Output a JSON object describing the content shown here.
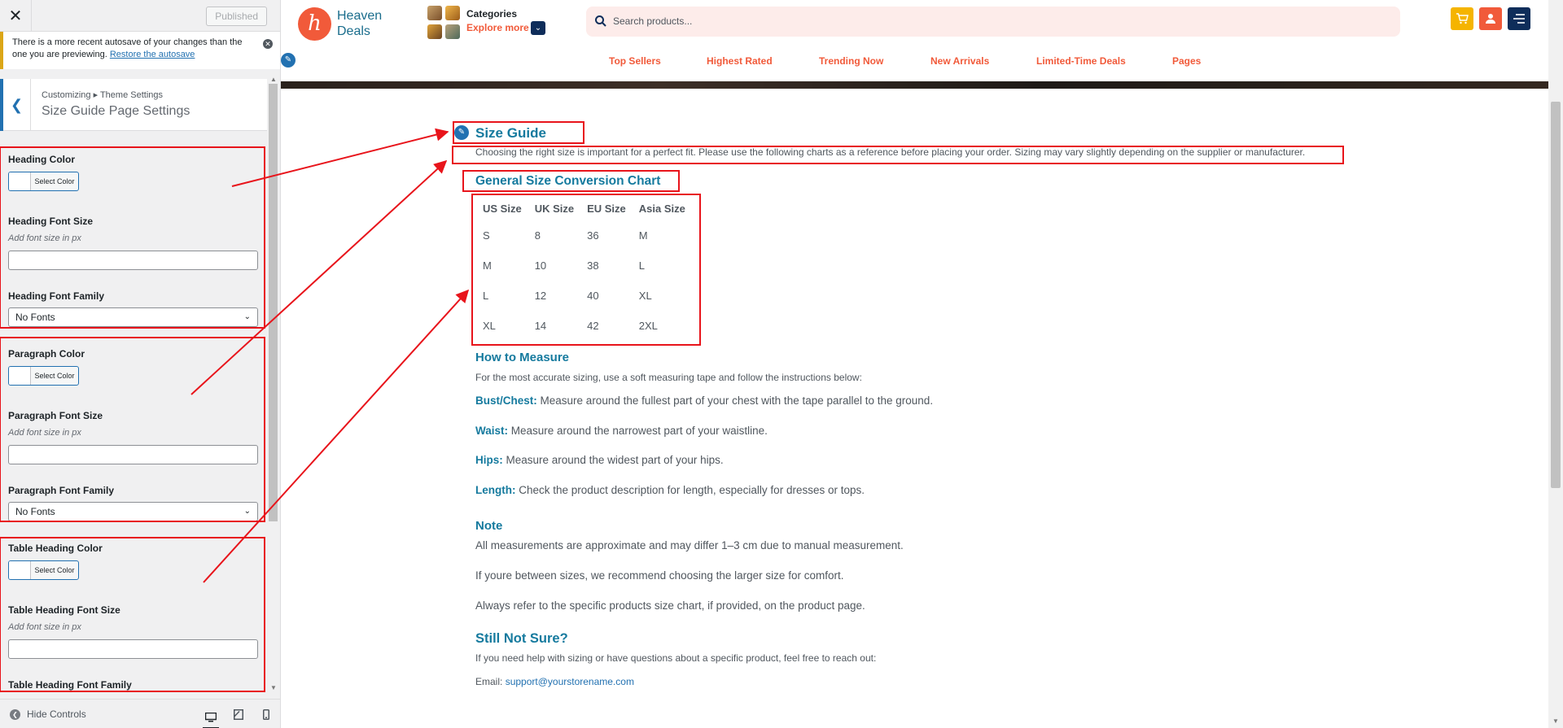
{
  "customizer": {
    "close_icon": "close-icon",
    "publish_label": "Published",
    "notice": {
      "text": "There is a more recent autosave of your changes than the one you are previewing.",
      "link": "Restore the autosave"
    },
    "breadcrumb": "Customizing ▸ Theme Settings",
    "section_title": "Size Guide Page Settings",
    "controls": {
      "heading_color_label": "Heading Color",
      "heading_font_size_label": "Heading Font Size",
      "heading_font_family_label": "Heading Font Family",
      "paragraph_color_label": "Paragraph Color",
      "paragraph_font_size_label": "Paragraph Font Size",
      "paragraph_font_family_label": "Paragraph Font Family",
      "table_heading_color_label": "Table Heading Color",
      "table_heading_font_size_label": "Table Heading Font Size",
      "table_heading_font_family_label": "Table Heading Font Family",
      "select_color_label": "Select Color",
      "font_size_desc": "Add font size in px",
      "font_family_value": "No Fonts"
    },
    "footer": {
      "hide_controls": "Hide Controls"
    }
  },
  "site": {
    "logo_letter": "h",
    "logo_line1": "Heaven",
    "logo_line2": "Deals",
    "categories_title": "Categories",
    "categories_explore": "Explore more",
    "search_placeholder": "Search products...",
    "nav": [
      "Top Sellers",
      "Highest Rated",
      "Trending Now",
      "New Arrivals",
      "Limited-Time Deals",
      "Pages"
    ],
    "accent_color": "#f15a3a",
    "heading_color": "#157a9e"
  },
  "page": {
    "title": "Size Guide",
    "intro": "Choosing the right size is important for a perfect fit. Please use the following charts as a reference before placing your order. Sizing may vary slightly depending on the supplier or manufacturer.",
    "chart_heading": "General Size Conversion Chart",
    "table": {
      "headers": [
        "US Size",
        "UK Size",
        "EU Size",
        "Asia Size"
      ],
      "rows": [
        [
          "S",
          "8",
          "36",
          "M"
        ],
        [
          "M",
          "10",
          "38",
          "L"
        ],
        [
          "L",
          "12",
          "40",
          "XL"
        ],
        [
          "XL",
          "14",
          "42",
          "2XL"
        ]
      ]
    },
    "measure_heading": "How to Measure",
    "measure_intro": "For the most accurate sizing, use a soft measuring tape and follow the instructions below:",
    "measures": [
      {
        "term": "Bust/Chest:",
        "text": "Measure around the fullest part of your chest with the tape parallel to the ground."
      },
      {
        "term": "Waist:",
        "text": "Measure around the narrowest part of your waistline."
      },
      {
        "term": "Hips:",
        "text": "Measure around the widest part of your hips."
      },
      {
        "term": "Length:",
        "text": "Check the product description for length, especially for dresses or tops."
      }
    ],
    "note_heading": "Note",
    "notes": [
      "All measurements are approximate and may differ 1–3 cm due to manual measurement.",
      "If youre between sizes, we recommend choosing the larger size for comfort.",
      "Always refer to the specific products size chart, if provided, on the product page."
    ],
    "support_heading": "Still Not Sure?",
    "support_text": "If you need help with sizing or have questions about a specific product, feel free to reach out:",
    "email_label": "Email:",
    "email": "support@yourstorename.com"
  }
}
